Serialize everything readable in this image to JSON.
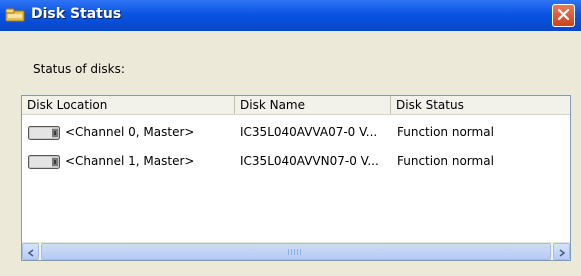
{
  "window": {
    "title": "Disk Status"
  },
  "content": {
    "status_label": "Status of disks:"
  },
  "list": {
    "columns": [
      "Disk Location",
      "Disk Name",
      "Disk Status"
    ],
    "rows": [
      {
        "location": "<Channel 0, Master>",
        "name": "IC35L040AVVA07-0 V...",
        "status": "Function normal",
        "icon": "hard-disk-icon"
      },
      {
        "location": "<Channel 1, Master>",
        "name": "IC35L040AVVN07-0 V...",
        "status": "Function normal",
        "icon": "hard-disk-icon"
      }
    ]
  },
  "colors": {
    "titlebar": "#0a54e3",
    "close_button": "#d9542e",
    "window_bg": "#ece9d8"
  }
}
